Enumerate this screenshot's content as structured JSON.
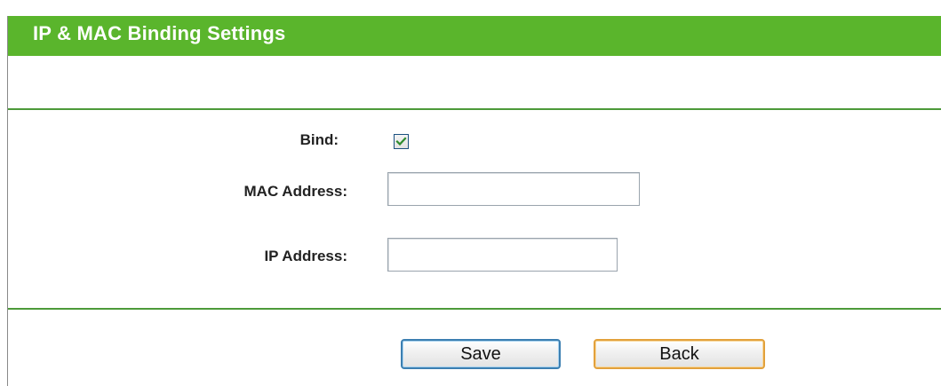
{
  "header": {
    "title": "IP & MAC Binding Settings"
  },
  "form": {
    "bind": {
      "label": "Bind:",
      "checked": true
    },
    "mac_address": {
      "label": "MAC Address:",
      "value": ""
    },
    "ip_address": {
      "label": "IP Address:",
      "value": ""
    }
  },
  "actions": {
    "save_label": "Save",
    "back_label": "Back"
  },
  "colors": {
    "title_bar": "#5ab52c",
    "divider": "#4d9a3a",
    "save_border": "#3c7fb1",
    "back_border": "#e2a13c",
    "checkmark": "#2e8b2e"
  },
  "icons": {
    "bind_checkbox": "checkmark-icon"
  }
}
